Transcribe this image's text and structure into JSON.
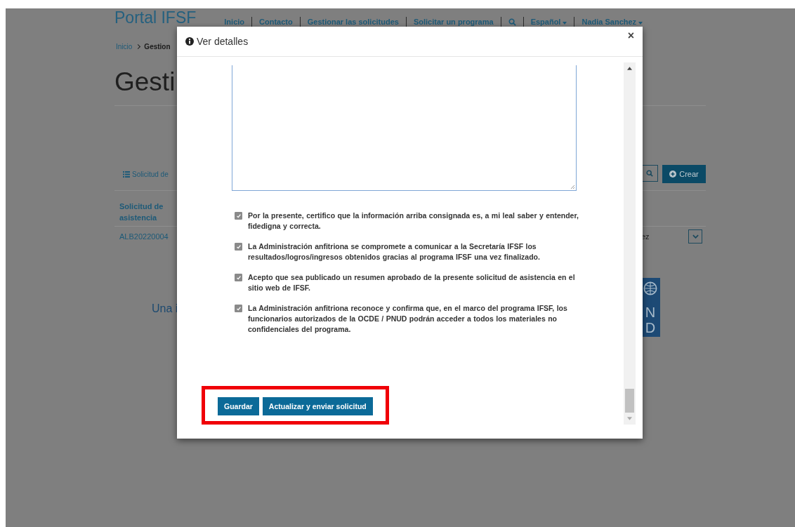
{
  "page": {
    "brand": "Portal IFSF",
    "nav": [
      {
        "label": "Inicio",
        "kind": "link"
      },
      {
        "label": "Contacto",
        "kind": "link"
      },
      {
        "label": "Gestionar las solicitudes",
        "kind": "link"
      },
      {
        "label": "Solicitar un programa",
        "kind": "link"
      },
      {
        "kind": "search"
      },
      {
        "label": "Español",
        "kind": "menu"
      },
      {
        "label": "Nadia Sanchez",
        "kind": "menu"
      }
    ],
    "breadcrumb": [
      "Inicio",
      "Gestion"
    ],
    "heading": "Gesti",
    "tab": "Solicitud de",
    "create_button": "Crear",
    "table": {
      "header": "Solicitud de asistencia",
      "row": {
        "id": "ALB20220004",
        "column_3": "ez"
      }
    },
    "footer": "Una i",
    "logo_letters": [
      "N",
      "D"
    ]
  },
  "modal": {
    "title": "Ver detalles",
    "close": "×",
    "declarations": [
      {
        "text": "Por la presente, certifico que la información arriba consignada es, a mi leal saber y entender, fidedigna y correcta.",
        "checked": true
      },
      {
        "text": "La Administración anfitriona se compromete a comunicar a la Secretaría IFSF los resultados/logros/ingresos obtenidos gracias al programa IFSF una vez finalizado.",
        "checked": true
      },
      {
        "text": "Acepto que sea publicado un resumen aprobado de la presente solicitud de asistencia en el sitio web de IFSF.",
        "checked": true
      },
      {
        "text": "La Administración anfitriona reconoce y confirma que, en el marco del programa IFSF, los funcionarios autorizados de la OCDE / PNUD podrán acceder a todos los materiales no confidenciales del programa.",
        "checked": true
      }
    ],
    "buttons": [
      "Guardar",
      "Actualizar y enviar solicitud"
    ]
  }
}
